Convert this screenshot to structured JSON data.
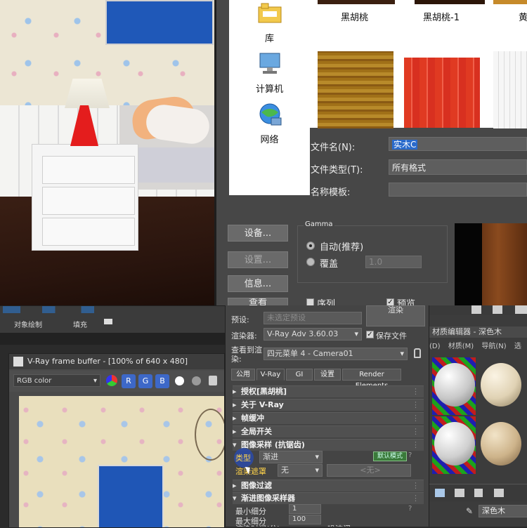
{
  "file_dialog": {
    "places": [
      {
        "label": "库",
        "icon": "library-icon"
      },
      {
        "label": "计算机",
        "icon": "computer-icon"
      },
      {
        "label": "网络",
        "icon": "network-icon"
      }
    ],
    "thumbnails": [
      {
        "label": "黑胡桃",
        "color": "#3b2010"
      },
      {
        "label": "黑胡桃-1",
        "color": "#2c1608"
      },
      {
        "label": "黄",
        "color": "#c68a2a"
      },
      {
        "label": "",
        "color": "#b07a1c"
      },
      {
        "label": "",
        "color": "#e2442a"
      },
      {
        "label": "",
        "color": "#f4f4f4"
      }
    ],
    "file_name_label": "文件名(N):",
    "file_name_value": "实木C",
    "file_type_label": "文件类型(T):",
    "file_type_value": "所有格式",
    "name_template_label": "名称模板:",
    "name_template_value": "",
    "setup_button": "设备...",
    "settings_button": "设置...",
    "info_button": "信息...",
    "view_button": "查看",
    "gamma_label": "Gamma",
    "auto_label": "自动(推荐)",
    "override_label": "覆盖",
    "override_value": "1.0",
    "sequence_label": "序列",
    "preview_label": "预览"
  },
  "toolstrip": {
    "object_paint": "对象绘制",
    "fill": "填充"
  },
  "vfb": {
    "title": "V-Ray frame buffer - [100% of 640 x 480]",
    "channel": "RGB color",
    "r": "R",
    "g": "G",
    "b": "B"
  },
  "render_setup": {
    "preset_label": "预设:",
    "preset_value": "未选定预设",
    "render_button": "渲染",
    "renderer_label": "渲染器:",
    "renderer_value": "V-Ray Adv 3.60.03",
    "save_file_label": "保存文件",
    "view_label": "查看到渲染:",
    "view_value": "四元菜单 4 - Camera01",
    "tabs": [
      "公用",
      "V-Ray",
      "GI",
      "设置",
      "Render Elements"
    ],
    "rollouts": [
      "授权[黑胡桃]",
      "关于 V-Ray",
      "帧缓冲",
      "全局开关",
      "图像采样 (抗锯齿)"
    ],
    "type_label": "类型",
    "type_value": "渐进",
    "default_mode": "默认模式",
    "render_mask_label": "渲染遮罩",
    "render_mask_value": "无",
    "none_placeholder": "<无>",
    "rollouts2": [
      "图像过滤",
      "渐进图像采样器"
    ],
    "min_subdiv_label": "最小细分",
    "min_subdiv_value": "1",
    "max_subdiv_label": "最大细分",
    "max_subdiv_value": "100",
    "render_time_label": "渲染时间(分)",
    "noise_label": "噪波阈"
  },
  "material_editor": {
    "title": "材质编辑器 - 深色木",
    "menu": [
      "(D)",
      "材质(M)",
      "导航(N)",
      "选"
    ],
    "material_name": "深色木"
  }
}
